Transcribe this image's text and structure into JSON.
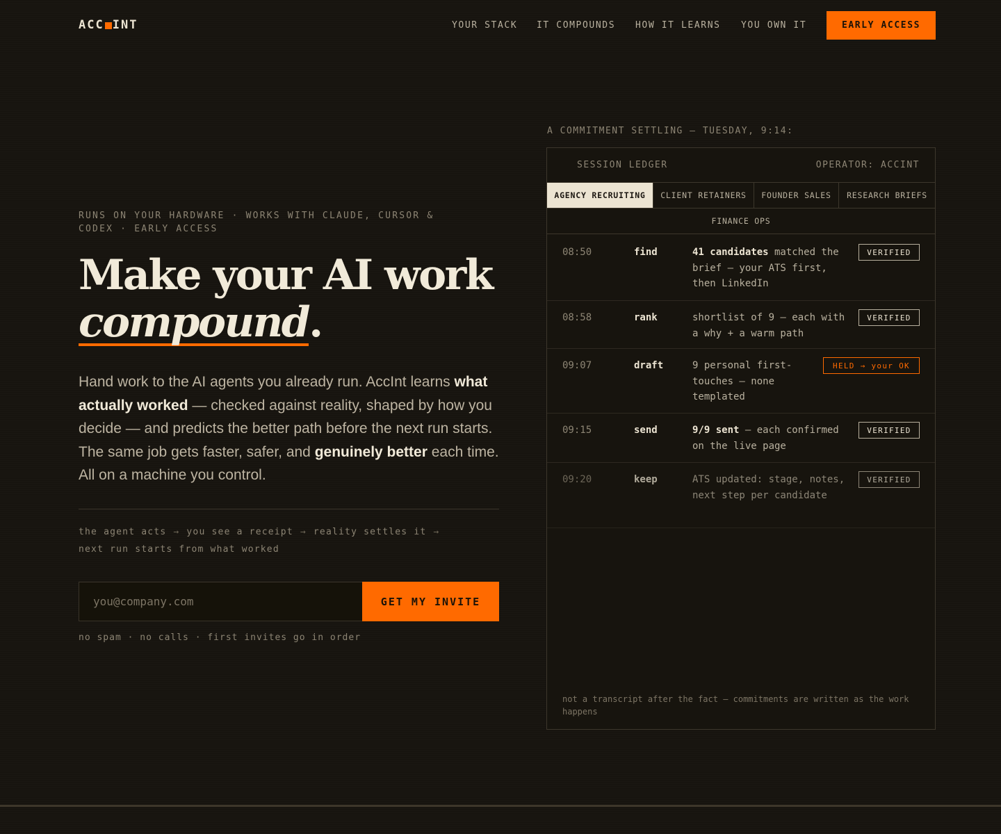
{
  "header": {
    "logo_left": "ACC",
    "logo_right": "INT",
    "nav": [
      "YOUR STACK",
      "IT COMPOUNDS",
      "HOW IT LEARNS",
      "YOU OWN IT"
    ],
    "cta": "EARLY ACCESS"
  },
  "hero": {
    "eyebrow": "RUNS ON YOUR HARDWARE · WORKS WITH CLAUDE, CURSOR & CODEX · EARLY ACCESS",
    "title_line1": "Make your AI work",
    "title_em": "compound",
    "title_end": ".",
    "lede": {
      "p1": "Hand work to the AI agents you already run. AccInt learns ",
      "b1": "what actually worked",
      "p2": " — checked against reality, shaped by how you decide — and predicts the better path before the next run starts. The same job gets faster, safer, and ",
      "b2": "genuinely better",
      "p3": " each time. All on a machine you control."
    },
    "flow": [
      "the agent acts",
      "you see a receipt",
      "reality settles it",
      "next run starts from what worked"
    ],
    "flow_arrow": "→",
    "email_placeholder": "you@company.com",
    "invite_button": "GET MY INVITE",
    "fine_print": "no spam · no calls · first invites go in order"
  },
  "ledger": {
    "caption": "A COMMITMENT SETTLING — TUESDAY, 9:14:",
    "title": "SESSION LEDGER",
    "operator": "OPERATOR: ACCINT",
    "tabs": [
      "AGENCY RECRUITING",
      "CLIENT RETAINERS",
      "FOUNDER SALES",
      "RESEARCH BRIEFS",
      "FINANCE OPS"
    ],
    "active_tab": "AGENCY RECRUITING",
    "rows": [
      {
        "time": "08:50",
        "verb": "find",
        "bold": "41 candidates",
        "text": " matched the brief — your ATS first, then LinkedIn",
        "status": "VERIFIED"
      },
      {
        "time": "08:58",
        "verb": "rank",
        "bold": "",
        "text": "shortlist of 9 — each with a why + a warm path",
        "status": "VERIFIED"
      },
      {
        "time": "09:07",
        "verb": "draft",
        "bold": "",
        "text": "9 personal first-touches — none templated",
        "status": "HELD → your OK"
      },
      {
        "time": "09:15",
        "verb": "send",
        "bold": "9/9 sent",
        "text": " — each confirmed on the live page",
        "status": "VERIFIED"
      },
      {
        "time": "09:20",
        "verb": "keep",
        "bold": "",
        "text": "ATS updated: stage, notes, next step per candidate",
        "status": "VERIFIED"
      }
    ],
    "footer": "not a transcript after the fact — commitments are written as the work happens"
  },
  "colors": {
    "accent": "#ff6a00",
    "background": "#17140f",
    "text": "#e9e2d2"
  }
}
